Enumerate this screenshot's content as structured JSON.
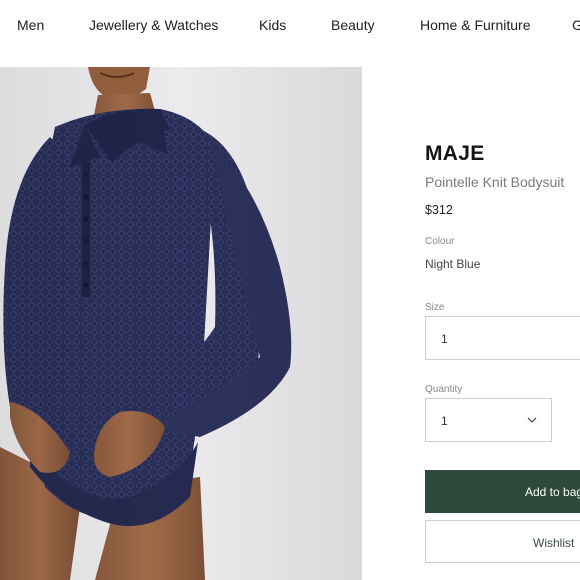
{
  "nav": {
    "items": [
      "Men",
      "Jewellery & Watches",
      "Kids",
      "Beauty",
      "Home & Furniture",
      "G"
    ]
  },
  "product": {
    "brand": "MAJE",
    "name": "Pointelle Knit Bodysuit",
    "price": "$312",
    "colour_label": "Colour",
    "colour_value": "Night Blue",
    "size_label": "Size",
    "size_value": "1",
    "quantity_label": "Quantity",
    "quantity_value": "1",
    "add_to_bag_label": "Add to bag",
    "wishlist_label": "Wishlist"
  },
  "colors": {
    "garment": "#2a2f58",
    "button_green": "#2e4a3a",
    "photo_bg": "#ebebed"
  }
}
